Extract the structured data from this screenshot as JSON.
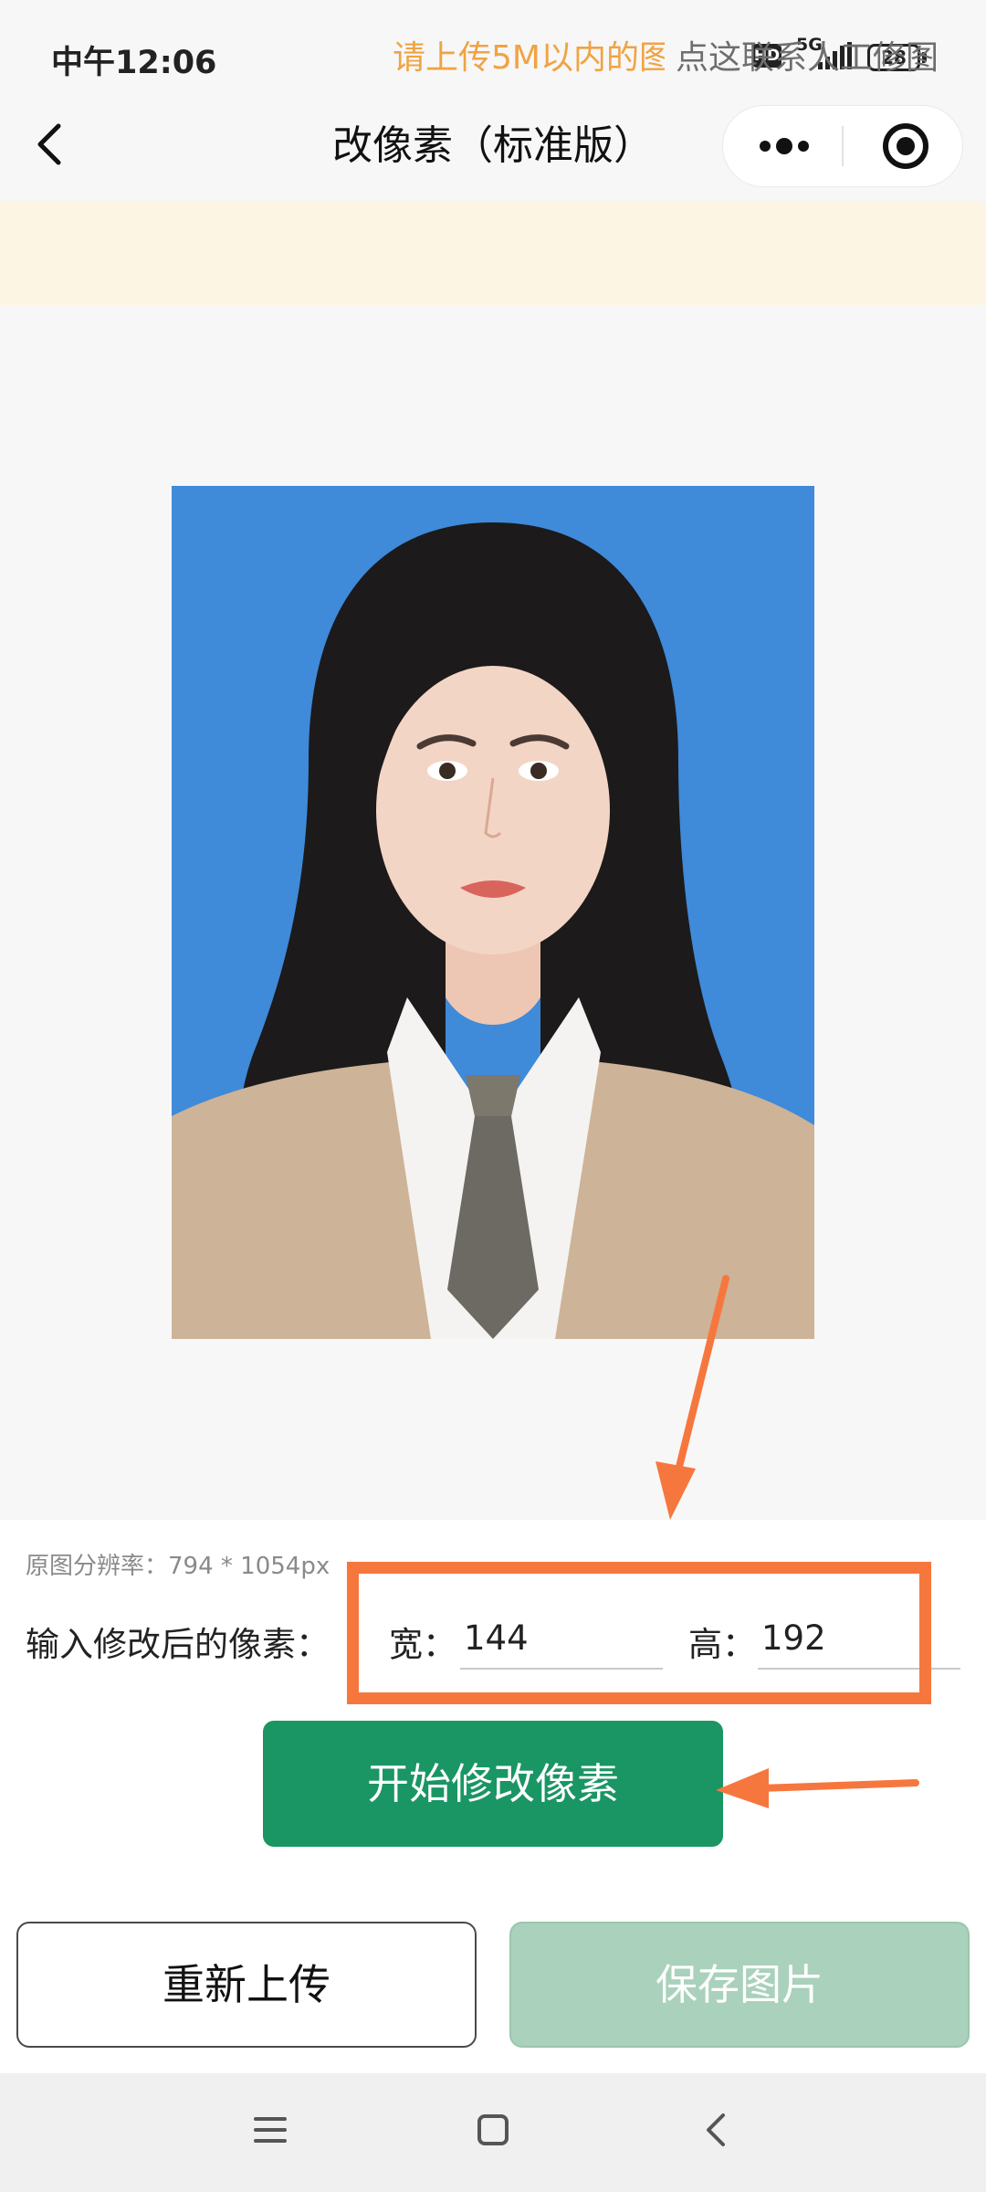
{
  "status_bar": {
    "time": "中午12:06",
    "hd_badge": "HD",
    "network": "5G",
    "battery": "28"
  },
  "nav": {
    "title": "改像素（标准版）",
    "back_icon": "chevron-left-icon",
    "more_icon": "more-dots-icon",
    "close_icon": "target-circle-icon"
  },
  "notice": {
    "text": "请上传5M以内的图",
    "contact_link": "点这联系人工修图"
  },
  "photo": {
    "background_color": "#3f8ad9"
  },
  "form": {
    "original_resolution": "原图分辨率：794 * 1054px",
    "input_label": "输入修改后的像素：",
    "width_label": "宽：",
    "width_value": "144",
    "height_label": "高：",
    "height_value": "192"
  },
  "buttons": {
    "start": "开始修改像素",
    "reupload": "重新上传",
    "save": "保存图片"
  },
  "colors": {
    "primary": "#1a9564",
    "disabled": "#a9d1bb",
    "annotation": "#f6773e",
    "notice_text": "#f0a343"
  },
  "system_nav": {
    "menu_icon": "menu-icon",
    "home_icon": "home-square-icon",
    "back_icon": "back-chevron-icon"
  }
}
